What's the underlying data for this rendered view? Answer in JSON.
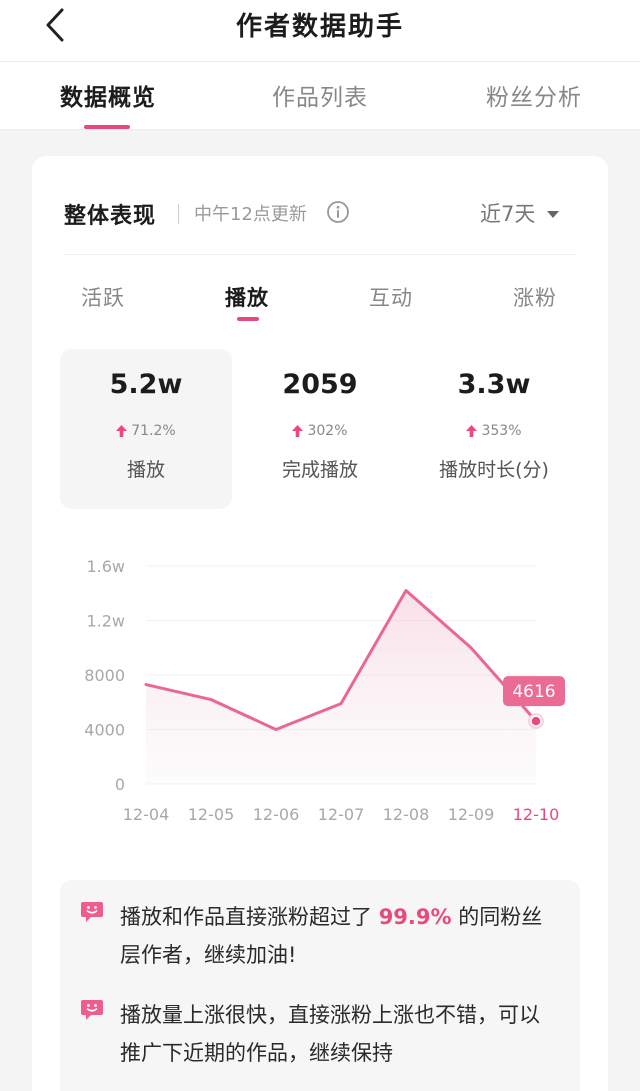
{
  "header": {
    "title": "作者数据助手",
    "back_icon": "chevron-left-icon"
  },
  "main_tabs": [
    {
      "label": "数据概览",
      "active": true
    },
    {
      "label": "作品列表",
      "active": false
    },
    {
      "label": "粉丝分析",
      "active": false
    }
  ],
  "overview": {
    "title": "整体表现",
    "update_note": "中午12点更新",
    "info_icon": "info-icon",
    "range": {
      "label": "近7天",
      "icon": "caret-down-icon"
    }
  },
  "sub_tabs": [
    {
      "label": "活跃",
      "active": false
    },
    {
      "label": "播放",
      "active": true
    },
    {
      "label": "互动",
      "active": false
    },
    {
      "label": "涨粉",
      "active": false
    }
  ],
  "metrics": [
    {
      "value": "5.2w",
      "change": "71.2%",
      "label": "播放",
      "selected": true
    },
    {
      "value": "2059",
      "change": "302%",
      "label": "完成播放",
      "selected": false
    },
    {
      "value": "3.3w",
      "change": "353%",
      "label": "播放时长(分)",
      "selected": false
    }
  ],
  "chart_data": {
    "type": "area",
    "title": "",
    "xlabel": "",
    "ylabel": "",
    "categories": [
      "12-04",
      "12-05",
      "12-06",
      "12-07",
      "12-08",
      "12-09",
      "12-10"
    ],
    "y_ticks": [
      {
        "value": 0,
        "label": "0"
      },
      {
        "value": 4000,
        "label": "4000"
      },
      {
        "value": 8000,
        "label": "8000"
      },
      {
        "value": 12000,
        "label": "1.2w"
      },
      {
        "value": 16000,
        "label": "1.6w"
      }
    ],
    "ylim": [
      0,
      16000
    ],
    "series": [
      {
        "values": [
          7300,
          6200,
          4000,
          5900,
          14200,
          10000,
          4616
        ]
      }
    ],
    "highlight": {
      "index": 6,
      "label": "4616"
    },
    "grid": true,
    "legend": "none",
    "colors": {
      "line": "#e8688f",
      "accent": "#e84b79",
      "tooltip": "#ea6b93"
    }
  },
  "tips": [
    {
      "before": "播放和作品直接涨粉超过了 ",
      "highlight": "99.9%",
      "after": " 的同粉丝层作者，继续加油!"
    },
    {
      "before": "播放量上涨很快，直接涨粉上涨也不错，可以推广下近期的作品，继续保持",
      "highlight": "",
      "after": ""
    }
  ],
  "tip_icon": "smiley-chat-icon",
  "tips_more_icon": "chevron-right-icon",
  "tips_more_glyph": "›",
  "colors": {
    "accent": "#e84b79",
    "text": "#1c1c1c",
    "muted": "#888888",
    "background": "#f4f4f5"
  }
}
